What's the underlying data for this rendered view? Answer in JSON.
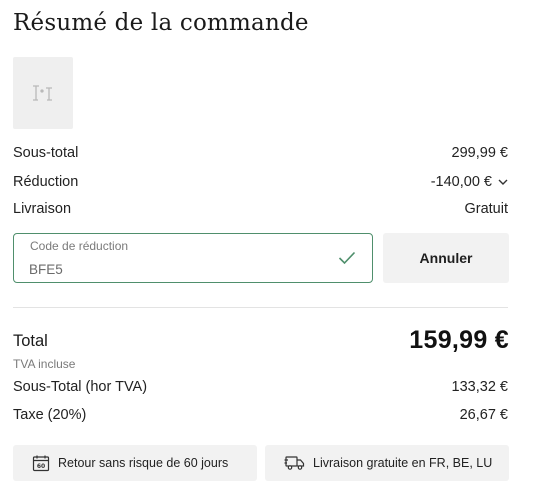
{
  "summary": {
    "title": "Résumé de la commande",
    "product_image_icon": "image-placeholder-icon",
    "lines": {
      "subtotal_label": "Sous-total",
      "subtotal_value": "299,99 €",
      "discount_label": "Réduction",
      "discount_value": "-140,00 €",
      "shipping_label": "Livraison",
      "shipping_value": "Gratuit"
    }
  },
  "discount_code": {
    "label": "Code de réduction",
    "value": "BFE5",
    "cancel_label": "Annuler"
  },
  "totals": {
    "total_label": "Total",
    "total_value": "159,99 €",
    "vat_note": "TVA incluse",
    "subtotal_excl_label": "Sous-Total (hor TVA)",
    "subtotal_excl_value": "133,32 €",
    "tax_label": "Taxe (20%)",
    "tax_value": "26,67 €"
  },
  "badges": {
    "returns": "Retour sans risque de 60 jours",
    "shipping": "Livraison gratuite en FR, BE, LU"
  },
  "colors": {
    "accent_green": "#4f8f6c",
    "badge_bg": "#f2f2f2"
  }
}
